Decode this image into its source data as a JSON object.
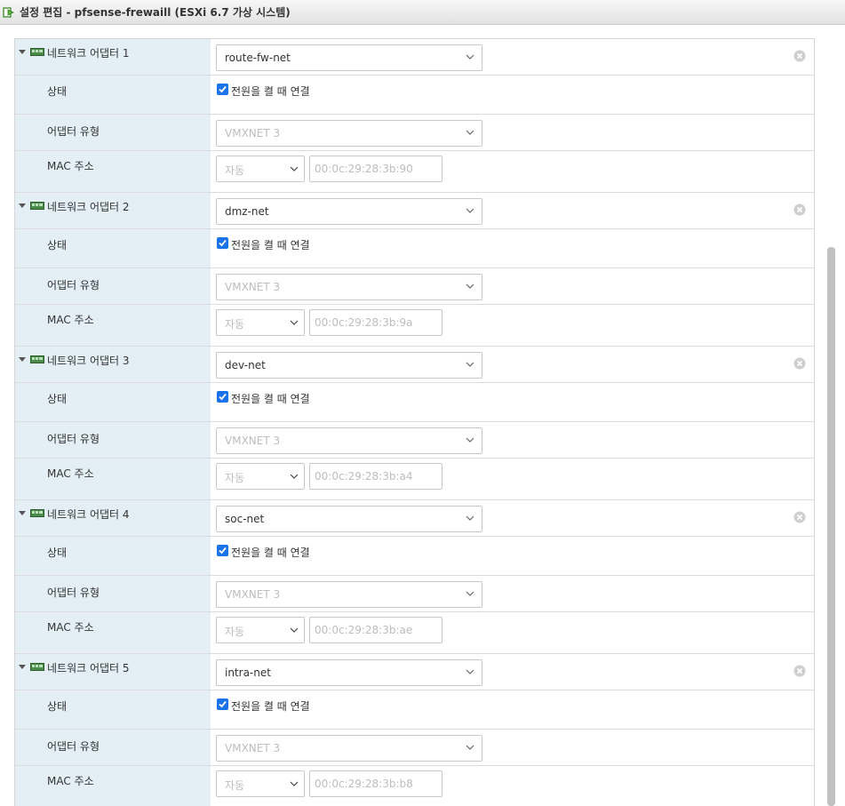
{
  "window": {
    "title": "설정 편집 - pfsense-frewaill (ESXi 6.7 가상 시스템)"
  },
  "labels": {
    "state": "상태",
    "adapter_type": "어댑터 유형",
    "mac": "MAC 주소",
    "connect_at_power_on": "전원을 켤 때 연결",
    "mac_mode": "자동"
  },
  "adapters": [
    {
      "name": "네트워크 어댑터 1",
      "network": "route-fw-net",
      "type": "VMXNET 3",
      "mac": "00:0c:29:28:3b:90"
    },
    {
      "name": "네트워크 어댑터 2",
      "network": "dmz-net",
      "type": "VMXNET 3",
      "mac": "00:0c:29:28:3b:9a"
    },
    {
      "name": "네트워크 어댑터 3",
      "network": "dev-net",
      "type": "VMXNET 3",
      "mac": "00:0c:29:28:3b:a4"
    },
    {
      "name": "네트워크 어댑터 4",
      "network": "soc-net",
      "type": "VMXNET 3",
      "mac": "00:0c:29:28:3b:ae"
    },
    {
      "name": "네트워크 어댑터 5",
      "network": "intra-net",
      "type": "VMXNET 3",
      "mac": "00:0c:29:28:3b:b8"
    }
  ],
  "icons": {
    "vm": "vm-settings-icon",
    "nic": "network-adapter-icon",
    "remove": "remove-circle-icon",
    "expand": "caret-down-icon"
  },
  "colors": {
    "label_bg": "#e3eef5",
    "checkbox": "#1a73e8"
  }
}
